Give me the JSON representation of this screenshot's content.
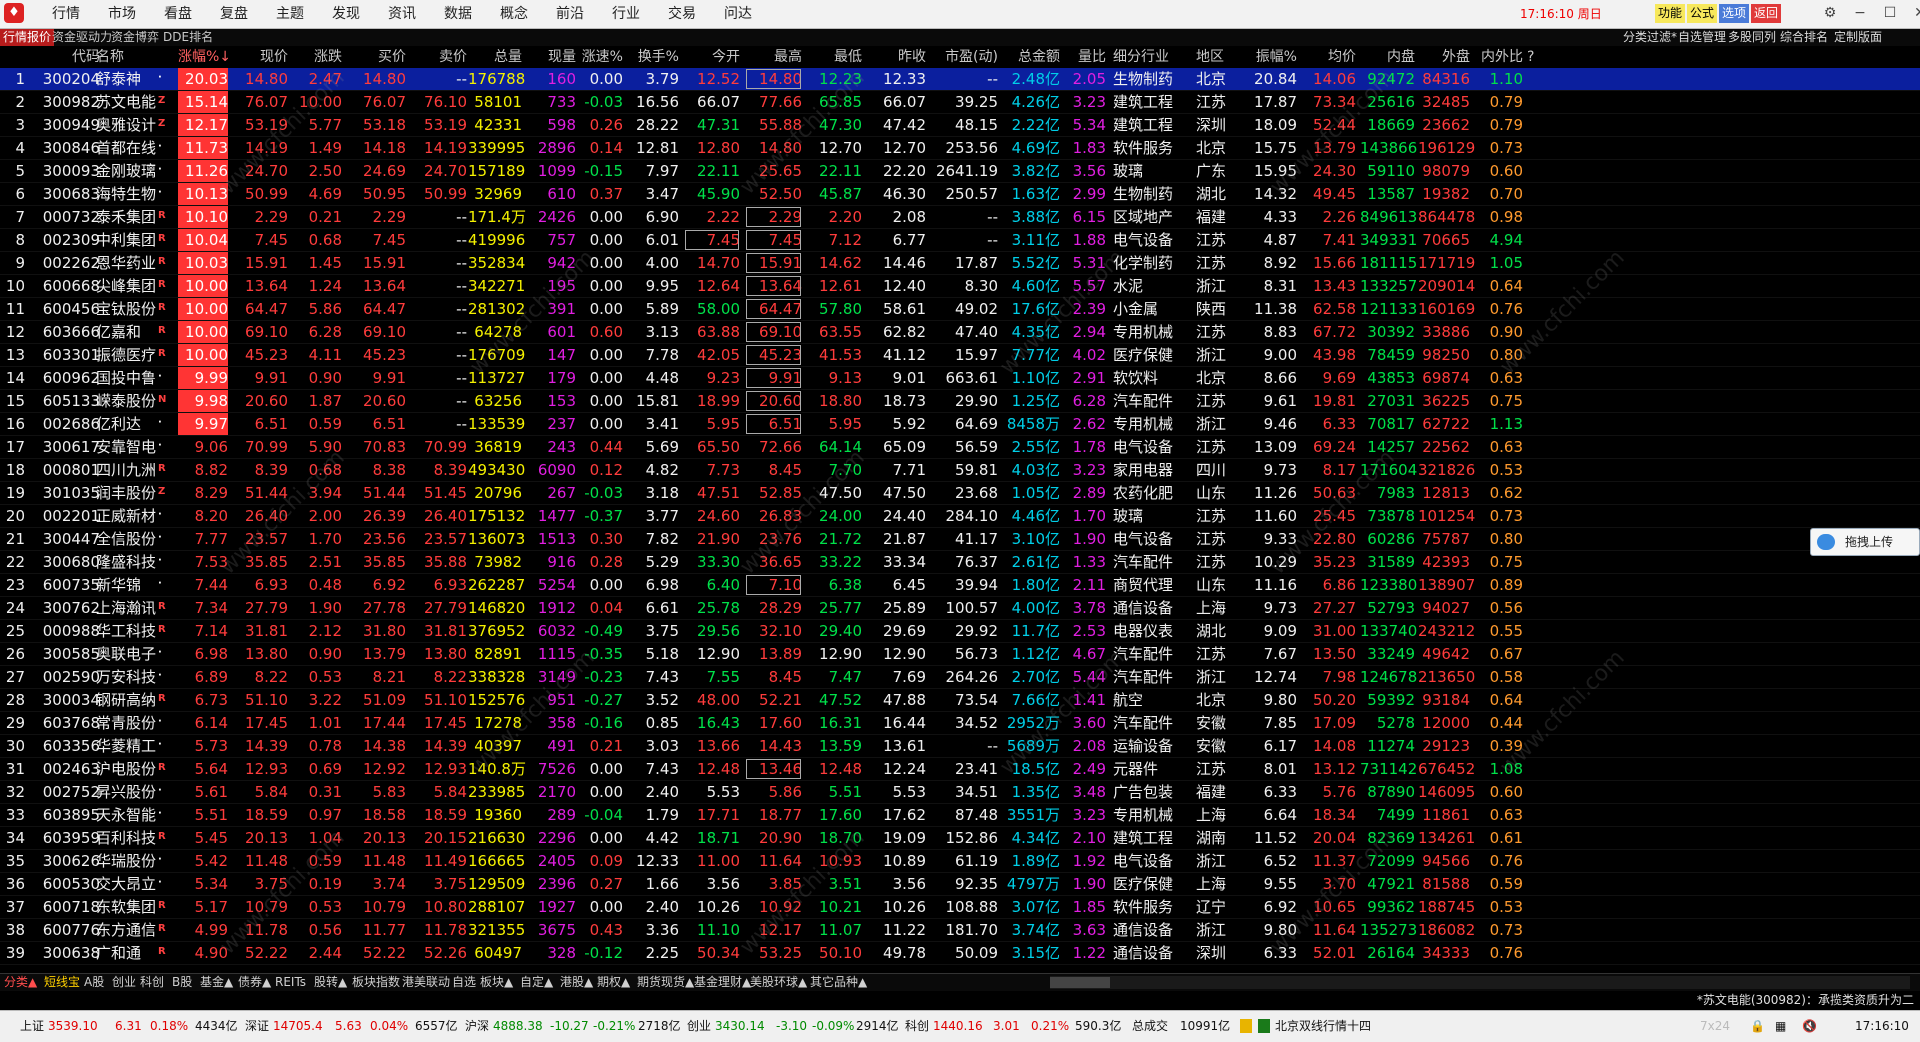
{
  "menu": [
    "行情",
    "市场",
    "看盘",
    "复盘",
    "主题",
    "发现",
    "资讯",
    "数据",
    "概念",
    "前沿",
    "行业",
    "交易",
    "问达"
  ],
  "clock": "17:16:10 周日",
  "top_buttons": [
    {
      "label": "功能",
      "bg": "#f7e85c"
    },
    {
      "label": "公式",
      "bg": "#f7e85c"
    },
    {
      "label": "选项",
      "bg": "#4a7bd8"
    },
    {
      "label": "返回",
      "bg": "#e03a3a"
    }
  ],
  "left_tabs": [
    "行情报价",
    "资金驱动力",
    "资金博弈",
    "DDE排名"
  ],
  "right_tabs": [
    "分类过滤*",
    "自选管理",
    "多股同列",
    "综合排名",
    "定制版面"
  ],
  "columns": [
    "",
    "代码",
    "名称",
    "",
    "涨幅%↓",
    "现价",
    "涨跌",
    "买价",
    "卖价",
    "总量",
    "现量",
    "涨速%",
    "换手%",
    "今开",
    "最高",
    "最低",
    "昨收",
    "市盈(动)",
    "总金额",
    "量比",
    "细分行业",
    "地区",
    "振幅%",
    "均价",
    "内盘",
    "外盘",
    "内外比",
    "?"
  ],
  "rows": [
    [
      "1",
      "300204",
      "舒泰神",
      "·",
      "20.03",
      "14.80",
      "2.47",
      "14.80",
      "--",
      "176788",
      "160",
      "0.00",
      "3.79",
      "12.52",
      "14.80",
      "12.23",
      "12.33",
      "--",
      "2.48亿",
      "2.05",
      "生物制药",
      "北京",
      "20.84",
      "14.06",
      "92472",
      "84316",
      "1.10"
    ],
    [
      "2",
      "300982",
      "苏文电能",
      "Z",
      "15.14",
      "76.07",
      "10.00",
      "76.07",
      "76.10",
      "58101",
      "733",
      "-0.03",
      "16.56",
      "66.07",
      "77.66",
      "65.85",
      "66.07",
      "39.25",
      "4.26亿",
      "3.23",
      "建筑工程",
      "江苏",
      "17.87",
      "73.34",
      "25616",
      "32485",
      "0.79"
    ],
    [
      "3",
      "300949",
      "奥雅设计",
      "Z",
      "12.17",
      "53.19",
      "5.77",
      "53.18",
      "53.19",
      "42331",
      "598",
      "0.26",
      "28.22",
      "47.31",
      "55.88",
      "47.30",
      "47.42",
      "48.15",
      "2.22亿",
      "5.34",
      "建筑工程",
      "深圳",
      "18.09",
      "52.44",
      "18669",
      "23662",
      "0.79"
    ],
    [
      "4",
      "300846",
      "首都在线",
      "·",
      "11.73",
      "14.19",
      "1.49",
      "14.18",
      "14.19",
      "339995",
      "2896",
      "0.14",
      "12.81",
      "12.80",
      "14.80",
      "12.70",
      "12.70",
      "253.56",
      "4.69亿",
      "1.83",
      "软件服务",
      "北京",
      "15.75",
      "13.79",
      "143866",
      "196129",
      "0.73"
    ],
    [
      "5",
      "300093",
      "金刚玻璃",
      "·",
      "11.26",
      "24.70",
      "2.50",
      "24.69",
      "24.70",
      "157189",
      "1099",
      "-0.15",
      "7.97",
      "22.11",
      "25.65",
      "22.11",
      "22.20",
      "2641.19",
      "3.82亿",
      "3.56",
      "玻璃",
      "广东",
      "15.95",
      "24.30",
      "59110",
      "98079",
      "0.60"
    ],
    [
      "6",
      "300683",
      "海特生物",
      "·",
      "10.13",
      "50.99",
      "4.69",
      "50.95",
      "50.99",
      "32969",
      "610",
      "0.37",
      "3.47",
      "45.90",
      "52.50",
      "45.87",
      "46.30",
      "250.57",
      "1.63亿",
      "2.99",
      "生物制药",
      "湖北",
      "14.32",
      "49.45",
      "13587",
      "19382",
      "0.70"
    ],
    [
      "7",
      "000732",
      "泰禾集团",
      "R",
      "10.10",
      "2.29",
      "0.21",
      "2.29",
      "--",
      "171.4万",
      "2426",
      "0.00",
      "6.90",
      "2.22",
      "2.29",
      "2.20",
      "2.08",
      "--",
      "3.88亿",
      "6.15",
      "区域地产",
      "福建",
      "4.33",
      "2.26",
      "849613",
      "864478",
      "0.98"
    ],
    [
      "8",
      "002309",
      "中利集团",
      "R",
      "10.04",
      "7.45",
      "0.68",
      "7.45",
      "--",
      "419996",
      "757",
      "0.00",
      "6.01",
      "7.45",
      "7.45",
      "7.12",
      "6.77",
      "--",
      "3.11亿",
      "1.88",
      "电气设备",
      "江苏",
      "4.87",
      "7.41",
      "349331",
      "70665",
      "4.94"
    ],
    [
      "9",
      "002262",
      "恩华药业",
      "R",
      "10.03",
      "15.91",
      "1.45",
      "15.91",
      "--",
      "352834",
      "942",
      "0.00",
      "4.00",
      "14.70",
      "15.91",
      "14.62",
      "14.46",
      "17.87",
      "5.52亿",
      "5.31",
      "化学制药",
      "江苏",
      "8.92",
      "15.66",
      "181115",
      "171719",
      "1.05"
    ],
    [
      "10",
      "600668",
      "尖峰集团",
      "R",
      "10.00",
      "13.64",
      "1.24",
      "13.64",
      "--",
      "342271",
      "195",
      "0.00",
      "9.95",
      "12.64",
      "13.64",
      "12.61",
      "12.40",
      "8.30",
      "4.60亿",
      "5.57",
      "水泥",
      "浙江",
      "8.31",
      "13.43",
      "133257",
      "209014",
      "0.64"
    ],
    [
      "11",
      "600456",
      "宝钛股份",
      "R",
      "10.00",
      "64.47",
      "5.86",
      "64.47",
      "--",
      "281302",
      "391",
      "0.00",
      "5.89",
      "58.00",
      "64.47",
      "57.80",
      "58.61",
      "49.02",
      "17.6亿",
      "2.39",
      "小金属",
      "陕西",
      "11.38",
      "62.58",
      "121133",
      "160169",
      "0.76"
    ],
    [
      "12",
      "603666",
      "亿嘉和",
      "R",
      "10.00",
      "69.10",
      "6.28",
      "69.10",
      "--",
      "64278",
      "601",
      "0.60",
      "3.13",
      "63.88",
      "69.10",
      "63.55",
      "62.82",
      "47.40",
      "4.35亿",
      "2.94",
      "专用机械",
      "江苏",
      "8.83",
      "67.72",
      "30392",
      "33886",
      "0.90"
    ],
    [
      "13",
      "603301",
      "振德医疗",
      "R",
      "10.00",
      "45.23",
      "4.11",
      "45.23",
      "--",
      "176709",
      "147",
      "0.00",
      "7.78",
      "42.05",
      "45.23",
      "41.53",
      "41.12",
      "15.97",
      "7.77亿",
      "4.02",
      "医疗保健",
      "浙江",
      "9.00",
      "43.98",
      "78459",
      "98250",
      "0.80"
    ],
    [
      "14",
      "600962",
      "国投中鲁",
      "·",
      "9.99",
      "9.91",
      "0.90",
      "9.91",
      "--",
      "113727",
      "179",
      "0.00",
      "4.48",
      "9.23",
      "9.91",
      "9.13",
      "9.01",
      "663.61",
      "1.10亿",
      "2.91",
      "软饮料",
      "北京",
      "8.66",
      "9.69",
      "43853",
      "69874",
      "0.63"
    ],
    [
      "15",
      "605133",
      "嵘泰股份",
      "N",
      "9.98",
      "20.60",
      "1.87",
      "20.60",
      "--",
      "63256",
      "153",
      "0.00",
      "15.81",
      "18.99",
      "20.60",
      "18.80",
      "18.73",
      "29.90",
      "1.25亿",
      "6.28",
      "汽车配件",
      "江苏",
      "9.61",
      "19.81",
      "27031",
      "36225",
      "0.75"
    ],
    [
      "16",
      "002686",
      "亿利达",
      "·",
      "9.97",
      "6.51",
      "0.59",
      "6.51",
      "--",
      "133539",
      "237",
      "0.00",
      "3.41",
      "5.95",
      "6.51",
      "5.95",
      "5.92",
      "64.69",
      "8458万",
      "2.62",
      "专用机械",
      "浙江",
      "9.46",
      "6.33",
      "70817",
      "62722",
      "1.13"
    ],
    [
      "17",
      "300617",
      "安靠智电",
      "·",
      "9.06",
      "70.99",
      "5.90",
      "70.83",
      "70.99",
      "36819",
      "243",
      "0.44",
      "5.69",
      "65.50",
      "72.66",
      "64.14",
      "65.09",
      "56.59",
      "2.55亿",
      "1.78",
      "电气设备",
      "江苏",
      "13.09",
      "69.24",
      "14257",
      "22562",
      "0.63"
    ],
    [
      "18",
      "000801",
      "四川九洲",
      "R",
      "8.82",
      "8.39",
      "0.68",
      "8.38",
      "8.39",
      "493430",
      "6090",
      "0.12",
      "4.82",
      "7.73",
      "8.45",
      "7.70",
      "7.71",
      "59.81",
      "4.03亿",
      "3.23",
      "家用电器",
      "四川",
      "9.73",
      "8.17",
      "171604",
      "321826",
      "0.53"
    ],
    [
      "19",
      "301035",
      "润丰股份",
      "Z",
      "8.29",
      "51.44",
      "3.94",
      "51.44",
      "51.45",
      "20796",
      "267",
      "-0.03",
      "3.18",
      "47.51",
      "52.85",
      "47.50",
      "47.50",
      "23.68",
      "1.05亿",
      "2.89",
      "农药化肥",
      "山东",
      "11.26",
      "50.63",
      "7983",
      "12813",
      "0.62"
    ],
    [
      "20",
      "002201",
      "正威新材",
      "·",
      "8.20",
      "26.40",
      "2.00",
      "26.39",
      "26.40",
      "175132",
      "1477",
      "-0.37",
      "3.77",
      "24.60",
      "26.83",
      "24.00",
      "24.40",
      "284.10",
      "4.46亿",
      "1.70",
      "玻璃",
      "江苏",
      "11.60",
      "25.45",
      "73878",
      "101254",
      "0.73"
    ],
    [
      "21",
      "300447",
      "全信股份",
      "·",
      "7.77",
      "23.57",
      "1.70",
      "23.56",
      "23.57",
      "136073",
      "1513",
      "0.30",
      "7.82",
      "21.90",
      "23.76",
      "21.72",
      "21.87",
      "41.17",
      "3.10亿",
      "1.90",
      "电气设备",
      "江苏",
      "9.33",
      "22.80",
      "60286",
      "75787",
      "0.80"
    ],
    [
      "22",
      "300680",
      "隆盛科技",
      "·",
      "7.53",
      "35.85",
      "2.51",
      "35.85",
      "35.88",
      "73982",
      "916",
      "0.28",
      "5.29",
      "33.30",
      "36.65",
      "33.22",
      "33.34",
      "76.37",
      "2.61亿",
      "1.33",
      "汽车配件",
      "江苏",
      "10.29",
      "35.23",
      "31589",
      "42393",
      "0.75"
    ],
    [
      "23",
      "600735",
      "新华锦",
      "·",
      "7.44",
      "6.93",
      "0.48",
      "6.92",
      "6.93",
      "262287",
      "5254",
      "0.00",
      "6.98",
      "6.40",
      "7.10",
      "6.38",
      "6.45",
      "39.94",
      "1.80亿",
      "2.11",
      "商贸代理",
      "山东",
      "11.16",
      "6.86",
      "123380",
      "138907",
      "0.89"
    ],
    [
      "24",
      "300762",
      "上海瀚讯",
      "R",
      "7.34",
      "27.79",
      "1.90",
      "27.78",
      "27.79",
      "146820",
      "1912",
      "0.04",
      "6.61",
      "25.78",
      "28.29",
      "25.77",
      "25.89",
      "100.57",
      "4.00亿",
      "3.78",
      "通信设备",
      "上海",
      "9.73",
      "27.27",
      "52793",
      "94027",
      "0.56"
    ],
    [
      "25",
      "000988",
      "华工科技",
      "R",
      "7.14",
      "31.81",
      "2.12",
      "31.80",
      "31.81",
      "376952",
      "6032",
      "-0.49",
      "3.75",
      "29.56",
      "32.10",
      "29.40",
      "29.69",
      "29.92",
      "11.7亿",
      "2.53",
      "电器仪表",
      "湖北",
      "9.09",
      "31.00",
      "133740",
      "243212",
      "0.55"
    ],
    [
      "26",
      "300585",
      "奥联电子",
      "·",
      "6.98",
      "13.80",
      "0.90",
      "13.79",
      "13.80",
      "82891",
      "1115",
      "-0.35",
      "5.18",
      "12.90",
      "13.89",
      "12.90",
      "12.90",
      "56.73",
      "1.12亿",
      "4.67",
      "汽车配件",
      "江苏",
      "7.67",
      "13.50",
      "33249",
      "49642",
      "0.67"
    ],
    [
      "27",
      "002590",
      "万安科技",
      "·",
      "6.89",
      "8.22",
      "0.53",
      "8.21",
      "8.22",
      "338328",
      "3149",
      "-0.23",
      "7.43",
      "7.55",
      "8.45",
      "7.47",
      "7.69",
      "264.26",
      "2.70亿",
      "5.44",
      "汽车配件",
      "浙江",
      "12.74",
      "7.98",
      "124678",
      "213650",
      "0.58"
    ],
    [
      "28",
      "300034",
      "钢研高纳",
      "R",
      "6.73",
      "51.10",
      "3.22",
      "51.09",
      "51.10",
      "152576",
      "951",
      "-0.27",
      "3.52",
      "48.00",
      "52.21",
      "47.52",
      "47.88",
      "73.54",
      "7.66亿",
      "1.41",
      "航空",
      "北京",
      "9.80",
      "50.20",
      "59392",
      "93184",
      "0.64"
    ],
    [
      "29",
      "603768",
      "常青股份",
      "·",
      "6.14",
      "17.45",
      "1.01",
      "17.44",
      "17.45",
      "17278",
      "358",
      "-0.16",
      "0.85",
      "16.43",
      "17.60",
      "16.31",
      "16.44",
      "34.52",
      "2952万",
      "3.60",
      "汽车配件",
      "安徽",
      "7.85",
      "17.09",
      "5278",
      "12000",
      "0.44"
    ],
    [
      "30",
      "603356",
      "华菱精工",
      "·",
      "5.73",
      "14.39",
      "0.78",
      "14.38",
      "14.39",
      "40397",
      "491",
      "0.21",
      "3.03",
      "13.66",
      "14.43",
      "13.59",
      "13.61",
      "--",
      "5689万",
      "2.08",
      "运输设备",
      "安徽",
      "6.17",
      "14.08",
      "11274",
      "29123",
      "0.39"
    ],
    [
      "31",
      "002463",
      "沪电股份",
      "R",
      "5.64",
      "12.93",
      "0.69",
      "12.92",
      "12.93",
      "140.8万",
      "7526",
      "0.00",
      "7.43",
      "12.48",
      "13.46",
      "12.48",
      "12.24",
      "23.41",
      "18.5亿",
      "2.49",
      "元器件",
      "江苏",
      "8.01",
      "13.12",
      "731142",
      "676452",
      "1.08"
    ],
    [
      "32",
      "002752",
      "昇兴股份",
      "·",
      "5.61",
      "5.84",
      "0.31",
      "5.83",
      "5.84",
      "233985",
      "2170",
      "0.00",
      "2.40",
      "5.53",
      "5.86",
      "5.51",
      "5.53",
      "34.51",
      "1.35亿",
      "3.48",
      "广告包装",
      "福建",
      "6.33",
      "5.76",
      "87890",
      "146095",
      "0.60"
    ],
    [
      "33",
      "603895",
      "天永智能",
      "·",
      "5.51",
      "18.59",
      "0.97",
      "18.58",
      "18.59",
      "19360",
      "289",
      "-0.04",
      "1.79",
      "17.71",
      "18.77",
      "17.60",
      "17.62",
      "87.48",
      "3551万",
      "3.23",
      "专用机械",
      "上海",
      "6.64",
      "18.34",
      "7499",
      "11861",
      "0.63"
    ],
    [
      "34",
      "603959",
      "百利科技",
      "R",
      "5.45",
      "20.13",
      "1.04",
      "20.13",
      "20.15",
      "216630",
      "2296",
      "0.00",
      "4.42",
      "18.71",
      "20.90",
      "18.70",
      "19.09",
      "152.86",
      "4.34亿",
      "2.10",
      "建筑工程",
      "湖南",
      "11.52",
      "20.04",
      "82369",
      "134261",
      "0.61"
    ],
    [
      "35",
      "300626",
      "华瑞股份",
      "·",
      "5.42",
      "11.48",
      "0.59",
      "11.48",
      "11.49",
      "166665",
      "2405",
      "0.09",
      "12.33",
      "11.00",
      "11.64",
      "10.93",
      "10.89",
      "61.19",
      "1.89亿",
      "1.92",
      "电气设备",
      "浙江",
      "6.52",
      "11.37",
      "72099",
      "94566",
      "0.76"
    ],
    [
      "36",
      "600530",
      "交大昂立",
      "·",
      "5.34",
      "3.75",
      "0.19",
      "3.74",
      "3.75",
      "129509",
      "2396",
      "0.27",
      "1.66",
      "3.56",
      "3.85",
      "3.51",
      "3.56",
      "92.35",
      "4797万",
      "1.90",
      "医疗保健",
      "上海",
      "9.55",
      "3.70",
      "47921",
      "81588",
      "0.59"
    ],
    [
      "37",
      "600718",
      "东软集团",
      "R",
      "5.17",
      "10.79",
      "0.53",
      "10.79",
      "10.80",
      "288107",
      "1927",
      "0.00",
      "2.40",
      "10.26",
      "10.92",
      "10.21",
      "10.26",
      "108.88",
      "3.07亿",
      "1.85",
      "软件服务",
      "辽宁",
      "6.92",
      "10.65",
      "99362",
      "188745",
      "0.53"
    ],
    [
      "38",
      "600776",
      "东方通信",
      "R",
      "4.99",
      "11.78",
      "0.56",
      "11.77",
      "11.78",
      "321355",
      "3675",
      "0.43",
      "3.36",
      "11.10",
      "12.17",
      "11.07",
      "11.22",
      "181.70",
      "3.74亿",
      "3.63",
      "通信设备",
      "浙江",
      "9.80",
      "11.64",
      "135273",
      "186082",
      "0.73"
    ],
    [
      "39",
      "300638",
      "广和通",
      "R",
      "4.90",
      "52.22",
      "2.44",
      "52.22",
      "52.26",
      "60497",
      "328",
      "-0.12",
      "2.25",
      "50.34",
      "53.25",
      "50.10",
      "49.78",
      "50.09",
      "3.15亿",
      "1.22",
      "通信设备",
      "深圳",
      "6.33",
      "52.01",
      "26164",
      "34333",
      "0.76"
    ]
  ],
  "bottom_tabs": [
    "分类▲",
    "短线宝",
    "A股",
    "创业",
    "科创",
    "B股",
    "基金▲",
    "债券▲",
    "REITs",
    "股转▲",
    "板块指数",
    "港美联动",
    "自选",
    "板块▲",
    "自定▲",
    "港股▲",
    "期权▲",
    "期货现货▲",
    "基金理财▲",
    "美股环球▲",
    "其它品种▲"
  ],
  "news": "*苏文电能(300982)：承揽类资质升为二",
  "upload_button": "拖拽上传",
  "status": {
    "sh_label": "上证",
    "sh_val": "3539.10",
    "sh_chg": "6.31",
    "sh_pct": "0.18%",
    "sh_amt": "4434亿",
    "sz_label": "深证",
    "sz_val": "14705.4",
    "sz_chg": "5.63",
    "sz_pct": "0.04%",
    "sz_amt": "6557亿",
    "hs_label": "沪深",
    "hs_val": "4888.38",
    "hs_chg": "-10.27",
    "hs_pct": "-0.21%",
    "hs_amt": "2718亿",
    "cy_label": "创业",
    "cy_val": "3430.14",
    "cy_chg": "-3.10",
    "cy_pct": "-0.09%",
    "cy_amt": "2914亿",
    "kc_label": "科创",
    "kc_val": "1440.16",
    "kc_chg": "3.01",
    "kc_pct": "0.21%",
    "kc_amt": "590.3亿",
    "total_label": "总成交",
    "total_val": "10991亿",
    "line": "北京双线行情十四",
    "time": "17:16:10",
    "faded": "7x24"
  }
}
